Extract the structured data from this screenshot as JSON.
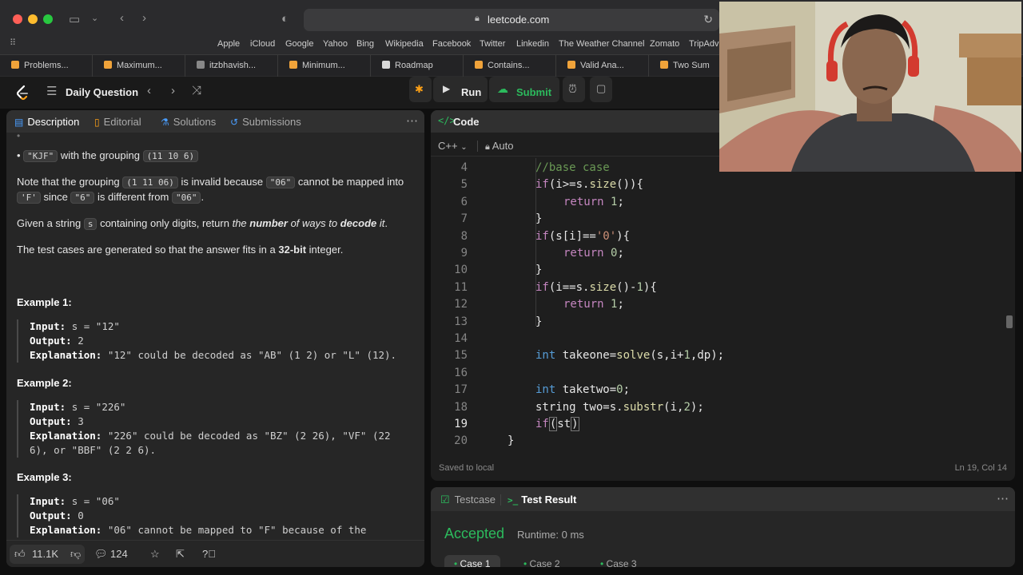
{
  "browser": {
    "url": "leetcode.com",
    "bookmarks": [
      "Apple",
      "iCloud",
      "Google",
      "Yahoo",
      "Bing",
      "Wikipedia",
      "Facebook",
      "Twitter",
      "Linkedin",
      "The Weather Channel",
      "Zomato",
      "TripAdv"
    ],
    "tabs": [
      "Problems...",
      "Maximum...",
      "itzbhavish...",
      "Minimum...",
      "Roadmap",
      "Contains...",
      "Valid Ana...",
      "Two Sum"
    ]
  },
  "header": {
    "daily_label": "Daily Question",
    "run_label": "Run",
    "submit_label": "Submit"
  },
  "left_panel": {
    "tabs": [
      "Description",
      "Editorial",
      "Solutions",
      "Submissions"
    ],
    "grouping_line_prefix": "with the grouping",
    "grouping_kjf_chip": "\"KJF\"",
    "grouping_kjf_value": "(11 10 6)",
    "note_line1_a": "Note that the grouping",
    "note_chip1": "(1 11 06)",
    "note_line1_b": "is invalid because",
    "note_chip2": "\"06\"",
    "note_line1_c": "cannot be mapped into",
    "note_chip3": "'F'",
    "note_line2_a": "since",
    "note_chip4": "\"6\"",
    "note_line2_b": "is different from",
    "note_chip5": "\"06\"",
    "given_a": "Given a string",
    "given_chip": "s",
    "given_b": "containing only digits, return",
    "given_c": "the",
    "given_d": "number",
    "given_e": "of ways to",
    "given_f": "decode",
    "given_g": "it",
    "testcases_a": "The test cases are generated so that the answer fits in a",
    "testcases_b": "32-bit",
    "testcases_c": "integer.",
    "examples": [
      {
        "title": "Example 1:",
        "input_label": "Input:",
        "input": "s = \"12\"",
        "output_label": "Output:",
        "output": "2",
        "expl_label": "Explanation:",
        "expl": "\"12\" could be decoded as \"AB\" (1 2) or \"L\" (12).",
        "expl2": ""
      },
      {
        "title": "Example 2:",
        "input_label": "Input:",
        "input": "s = \"226\"",
        "output_label": "Output:",
        "output": "3",
        "expl_label": "Explanation:",
        "expl": "\"226\" could be decoded as \"BZ\" (2 26), \"VF\" (22",
        "expl2": "6), or \"BBF\" (2 2 6)."
      },
      {
        "title": "Example 3:",
        "input_label": "Input:",
        "input": "s = \"06\"",
        "output_label": "Output:",
        "output": "0",
        "expl_label": "Explanation:",
        "expl": "\"06\" cannot be mapped to \"F\" because of the",
        "expl2": ""
      }
    ],
    "footer": {
      "likes": "11.1K",
      "comments": "124"
    }
  },
  "code_panel": {
    "tab_label": "Code",
    "language": "C++",
    "autosave": "Auto",
    "saved_label": "Saved to local",
    "cursor_pos": "Ln 19, Col 14"
  },
  "code_lines": [
    {
      "n": "4"
    },
    {
      "n": "5"
    },
    {
      "n": "6"
    },
    {
      "n": "7"
    },
    {
      "n": "8"
    },
    {
      "n": "9"
    },
    {
      "n": "10"
    },
    {
      "n": "11"
    },
    {
      "n": "12"
    },
    {
      "n": "13"
    },
    {
      "n": "14"
    },
    {
      "n": "15"
    },
    {
      "n": "16"
    },
    {
      "n": "17"
    },
    {
      "n": "18"
    },
    {
      "n": "19"
    },
    {
      "n": "20"
    }
  ],
  "result_panel": {
    "tabs": [
      "Testcase",
      "Test Result"
    ],
    "status": "Accepted",
    "runtime": "Runtime: 0 ms",
    "cases": [
      "Case 1",
      "Case 2",
      "Case 3"
    ]
  },
  "colors": {
    "accepted": "#2cbb5d",
    "lc_orange": "#ffa116"
  }
}
